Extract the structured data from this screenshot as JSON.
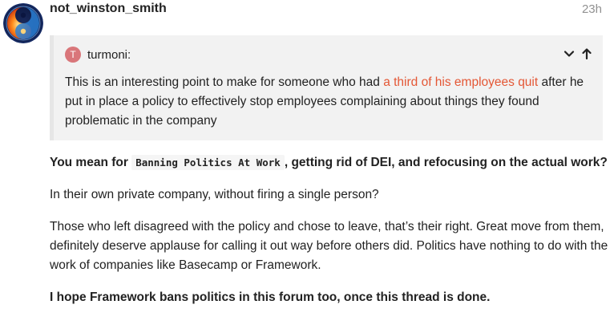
{
  "post": {
    "username": "not_winston_smith",
    "time": "23h",
    "avatar": "yin-yang-avatar"
  },
  "quote": {
    "user": "turmoni:",
    "avatar_letter": "T",
    "avatar_color": "#d9767a",
    "text_before": "This is an interesting point to make for someone who had ",
    "link_text": "a third of his employees quit",
    "text_after": " after he put in place a policy to effectively stop employees complaining about things they found problematic in the company",
    "controls": [
      "chevron-down-icon",
      "arrow-up-icon"
    ]
  },
  "body": {
    "p1_before": "You mean for ",
    "p1_code": "Banning Politics At Work",
    "p1_after": ", getting rid of DEI, and refocusing on the actual work?",
    "p2": "In their own private company, without firing a single person?",
    "p3": "Those who left disagreed with the policy and chose to leave, that’s their right. Great move from them, definitely deserve applause for calling it out way before others did. Politics have nothing to do with the work of companies like Basecamp or Framework.",
    "p4": "I hope Framework bans politics in this forum too, once this thread is done."
  },
  "colors": {
    "link": "#e45735",
    "quote_bg": "#f2f2f2",
    "quote_border": "#e6e6e6",
    "muted": "#919191"
  }
}
